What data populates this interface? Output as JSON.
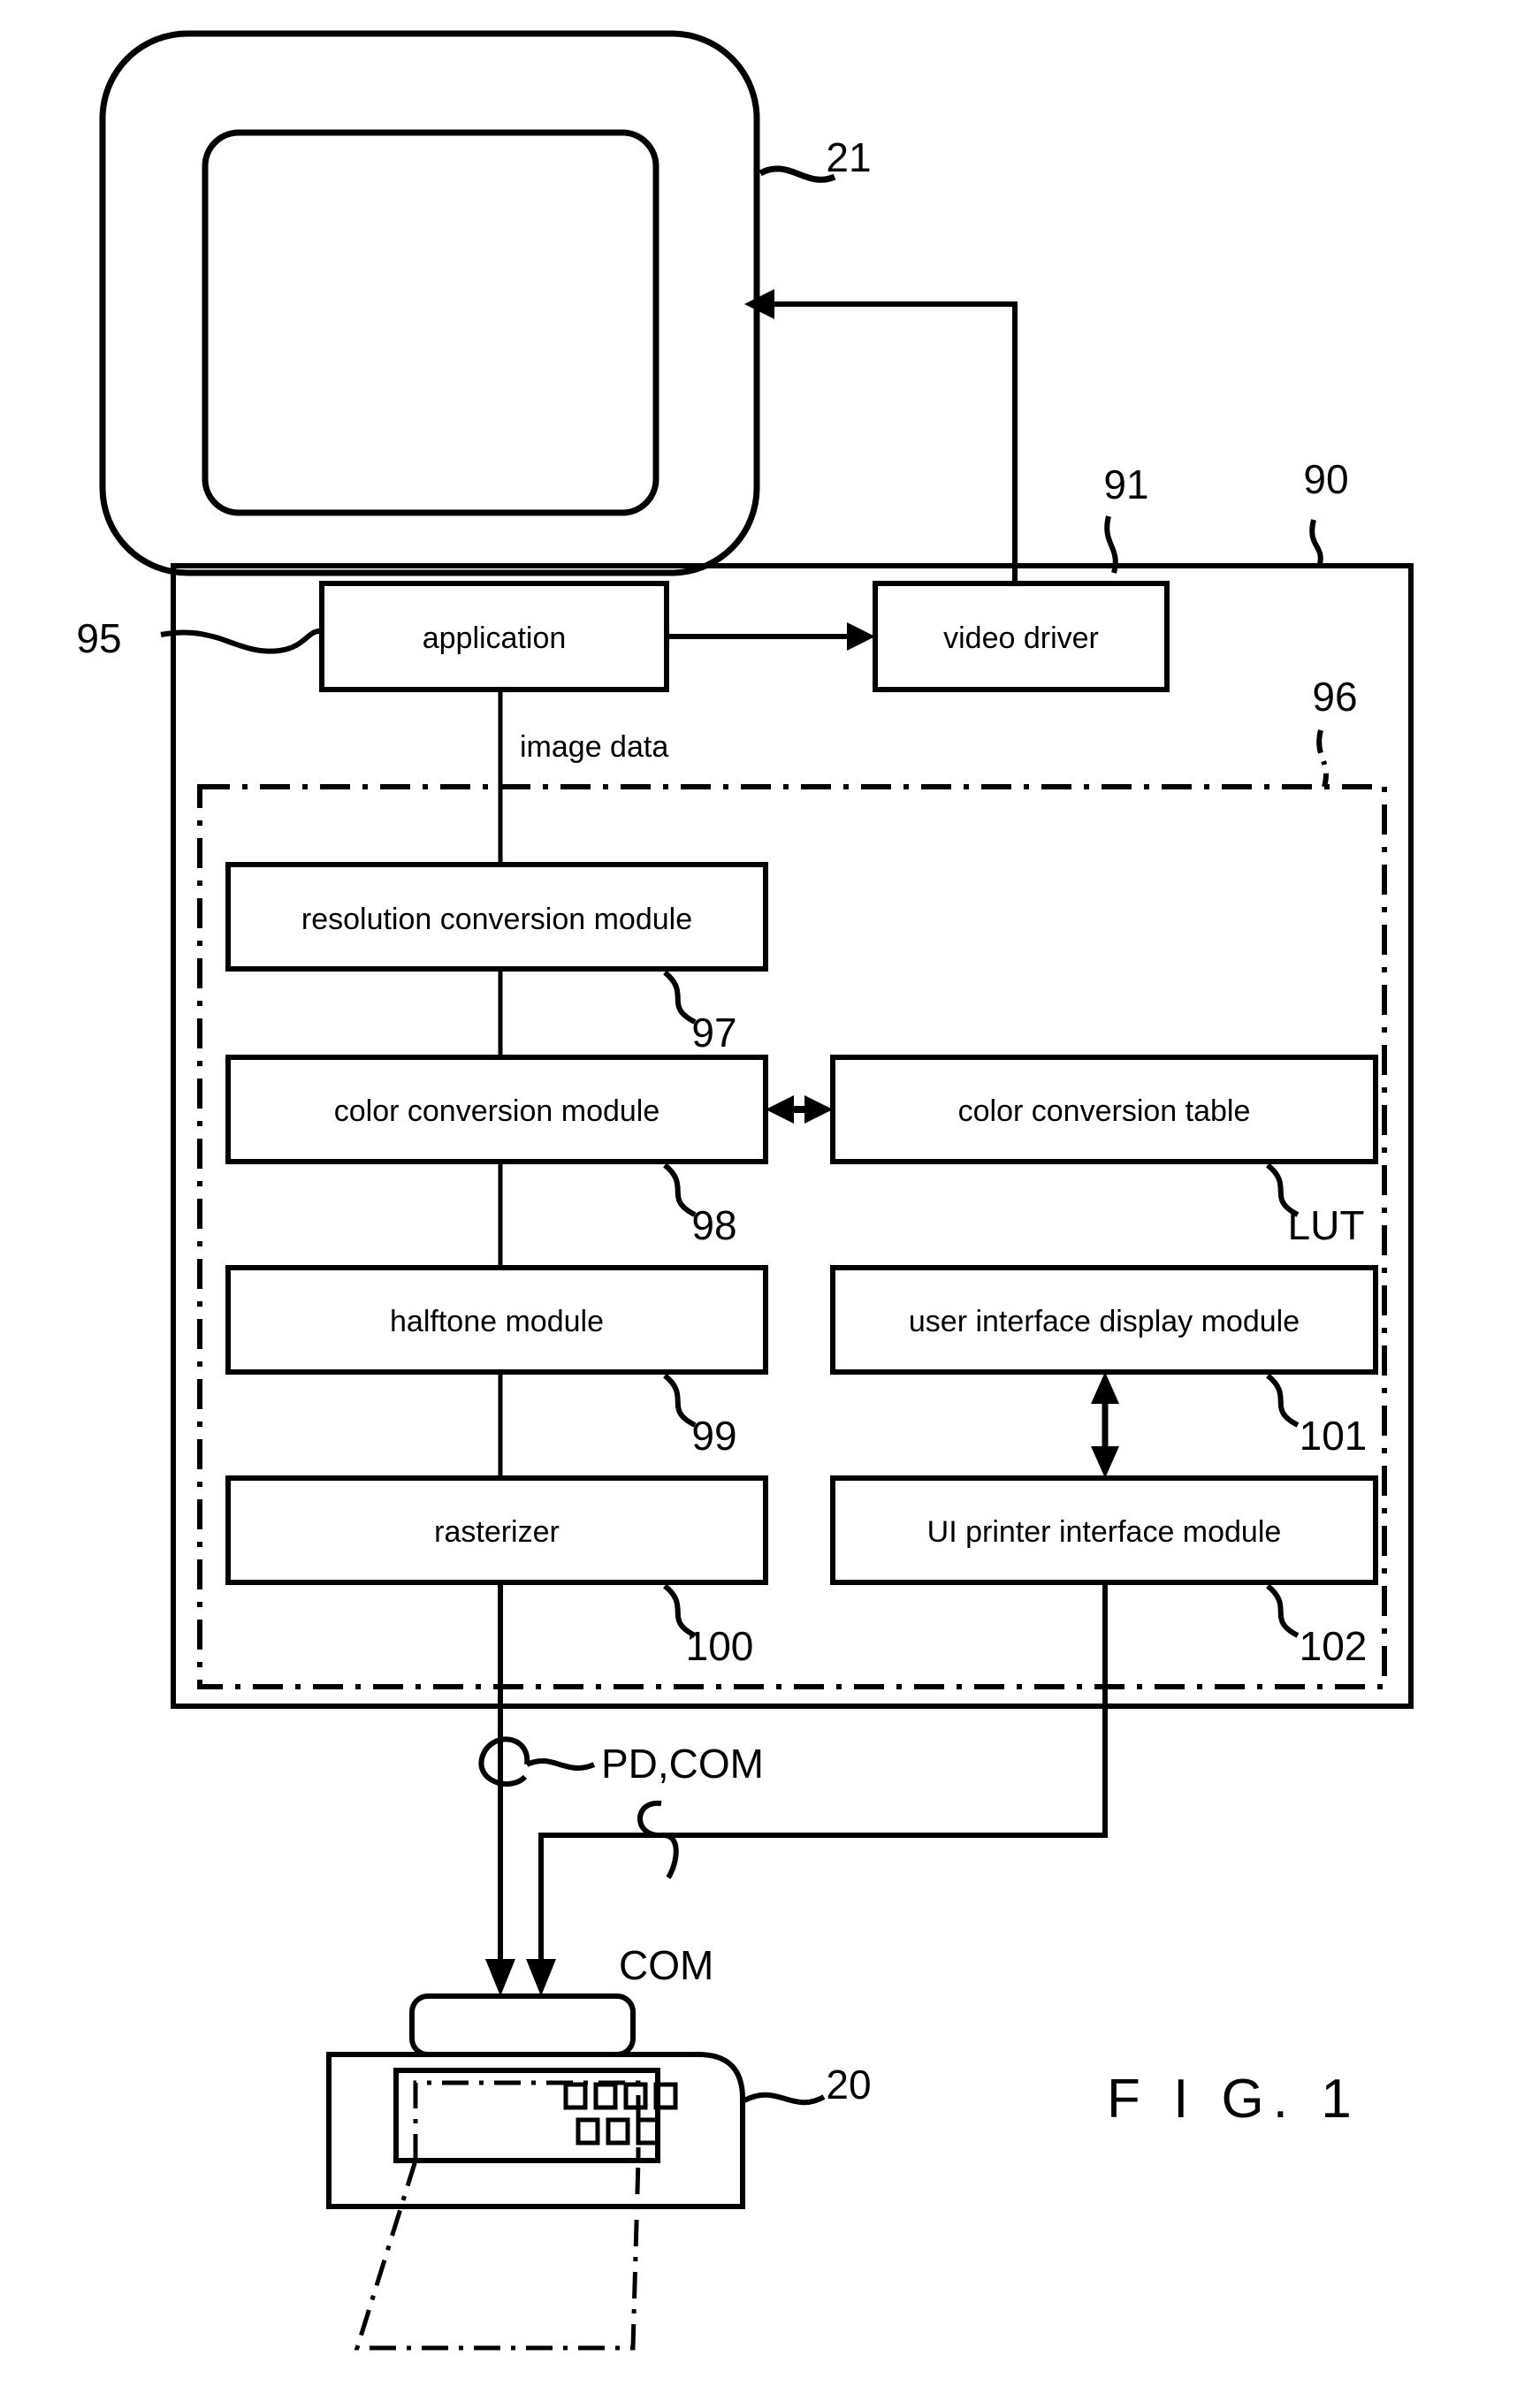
{
  "figure": {
    "title": "F I G.  1",
    "caption_number": "1"
  },
  "devices": {
    "monitor": {
      "name": "monitor",
      "ref": "21"
    },
    "printer": {
      "name": "printer",
      "ref": "20"
    }
  },
  "computer": {
    "ref": "90",
    "printer_driver_region_ref": "96"
  },
  "boxes": [
    {
      "id": "application",
      "label": "application",
      "ref": "95"
    },
    {
      "id": "video_driver",
      "label": "video driver",
      "ref": "91"
    },
    {
      "id": "resolution_module",
      "label": "resolution conversion module",
      "ref": "97"
    },
    {
      "id": "color_module",
      "label": "color conversion module",
      "ref": "98"
    },
    {
      "id": "color_table",
      "label": "color conversion table",
      "ref": "LUT"
    },
    {
      "id": "halftone_module",
      "label": "halftone module",
      "ref": "99"
    },
    {
      "id": "ui_display_module",
      "label": "user interface display module",
      "ref": "101"
    },
    {
      "id": "rasterizer",
      "label": "rasterizer",
      "ref": "100"
    },
    {
      "id": "ui_printer_module",
      "label": "UI printer interface module",
      "ref": "102"
    }
  ],
  "edge_labels": {
    "image_data": "image data",
    "pd_com": "PD,COM",
    "com": "COM"
  },
  "colors": {
    "ink": "#000000",
    "paper": "#ffffff"
  }
}
